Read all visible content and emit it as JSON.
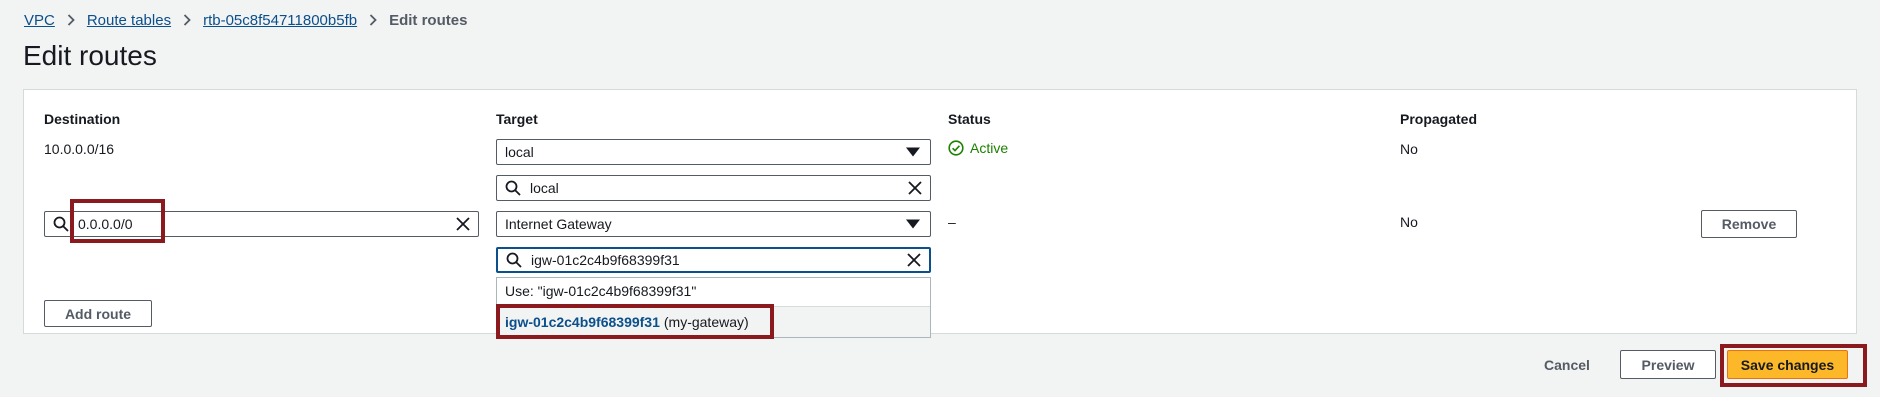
{
  "breadcrumb": {
    "vpc": "VPC",
    "route_tables": "Route tables",
    "route_table_id": "rtb-05c8f54711800b5fb",
    "current": "Edit routes"
  },
  "page_title": "Edit routes",
  "columns": {
    "destination": "Destination",
    "target": "Target",
    "status": "Status",
    "propagated": "Propagated"
  },
  "routes": [
    {
      "destination": "10.0.0.0/16",
      "target_select": "local",
      "target_filter": "local",
      "status": "Active",
      "propagated": "No"
    },
    {
      "destination_input": "0.0.0.0/0",
      "target_select": "Internet Gateway",
      "target_filter": "igw-01c2c4b9f68399f31",
      "status": "–",
      "propagated": "No",
      "remove_label": "Remove"
    }
  ],
  "target_dropdown": {
    "use_option": "Use: \"igw-01c2c4b9f68399f31\"",
    "option_id": "igw-01c2c4b9f68399f31",
    "option_name": "(my-gateway)"
  },
  "actions": {
    "add_route": "Add route",
    "cancel": "Cancel",
    "preview": "Preview",
    "save": "Save changes"
  },
  "colors": {
    "link": "#0b4f8c",
    "status_active": "#1d8102",
    "primary_button": "#fcb829",
    "highlight_box": "#8b1a1f"
  }
}
